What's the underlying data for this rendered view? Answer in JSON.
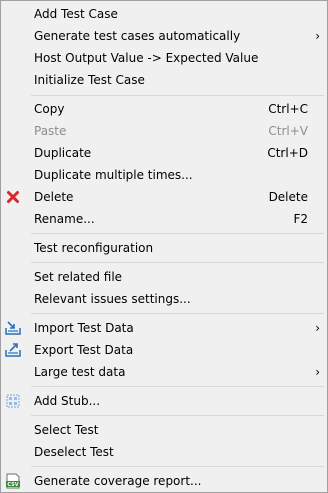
{
  "menu": {
    "group1": {
      "add_test_case": "Add Test Case",
      "generate_test_cases": "Generate test cases automatically",
      "host_output": "Host Output Value -> Expected Value",
      "initialize_test_case": "Initialize Test Case"
    },
    "group2": {
      "copy": "Copy",
      "copy_shortcut": "Ctrl+C",
      "paste": "Paste",
      "paste_shortcut": "Ctrl+V",
      "duplicate": "Duplicate",
      "duplicate_shortcut": "Ctrl+D",
      "duplicate_multiple": "Duplicate multiple times...",
      "delete": "Delete",
      "delete_shortcut": "Delete",
      "rename": "Rename...",
      "rename_shortcut": "F2"
    },
    "group3": {
      "test_reconfiguration": "Test reconfiguration"
    },
    "group4": {
      "set_related_file": "Set related file",
      "relevant_issues": "Relevant issues settings..."
    },
    "group5": {
      "import_test_data": "Import Test Data",
      "export_test_data": "Export Test Data",
      "large_test_data": "Large test data"
    },
    "group6": {
      "add_stub": "Add Stub..."
    },
    "group7": {
      "select_test": "Select Test",
      "deselect_test": "Deselect Test"
    },
    "group8": {
      "generate_coverage": "Generate coverage report...",
      "csv_icon_text": "CSV"
    },
    "submenu_arrow": "›"
  },
  "colors": {
    "menu_background": "#f0f0f0",
    "menu_border": "#a0a0a0",
    "separator": "#d8d8d8",
    "disabled_text": "#8d8d8d",
    "delete_icon_red": "#d9262b",
    "import_export_icon_blue": "#2a6fb8"
  },
  "icons": {
    "delete": "red-x-icon",
    "import": "import-data-icon",
    "export": "export-data-icon",
    "add_stub": "stub-icon",
    "coverage": "csv-file-icon"
  },
  "state": {
    "paste_enabled": false
  }
}
